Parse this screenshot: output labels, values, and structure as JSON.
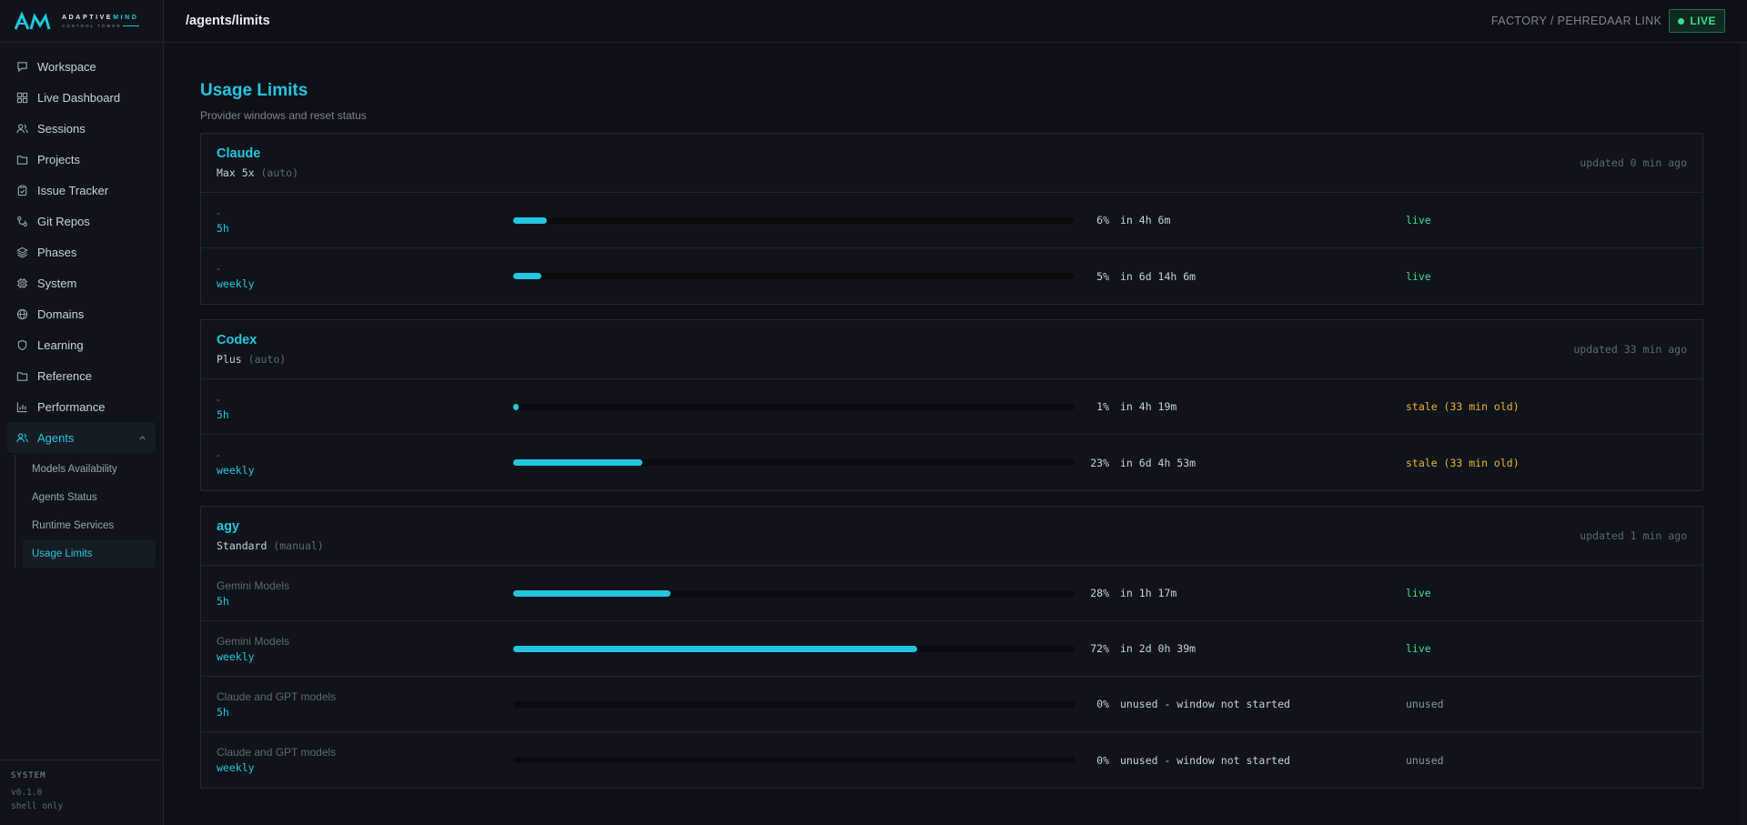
{
  "brand": {
    "name_a": "ADAPTIVE",
    "name_b": "MIND",
    "sub": "CONTROL TOWER"
  },
  "nav": {
    "items": [
      {
        "label": "Workspace",
        "icon": "chat-icon"
      },
      {
        "label": "Live Dashboard",
        "icon": "grid-icon"
      },
      {
        "label": "Sessions",
        "icon": "users-icon"
      },
      {
        "label": "Projects",
        "icon": "folder-icon"
      },
      {
        "label": "Issue Tracker",
        "icon": "clipboard-icon"
      },
      {
        "label": "Git Repos",
        "icon": "git-icon"
      },
      {
        "label": "Phases",
        "icon": "layers-icon"
      },
      {
        "label": "System",
        "icon": "cpu-icon"
      },
      {
        "label": "Domains",
        "icon": "globe-icon"
      },
      {
        "label": "Learning",
        "icon": "shield-icon"
      },
      {
        "label": "Reference",
        "icon": "folder-icon"
      },
      {
        "label": "Performance",
        "icon": "bar-chart-icon"
      },
      {
        "label": "Agents",
        "icon": "users-icon"
      }
    ],
    "agents_sub": [
      {
        "label": "Models Availability"
      },
      {
        "label": "Agents Status"
      },
      {
        "label": "Runtime Services"
      },
      {
        "label": "Usage Limits"
      }
    ]
  },
  "system": {
    "label": "SYSTEM",
    "version": "v0.1.0",
    "mode": "shell only"
  },
  "topbar": {
    "route": "/agents/limits",
    "factory": "FACTORY / PEHREDAAR LINK",
    "live": "LIVE"
  },
  "page": {
    "title": "Usage Limits",
    "subtitle": "Provider windows and reset status"
  },
  "colors": {
    "accent": "#22c6e0",
    "live": "#3ddc97",
    "stale": "#f0b429",
    "unused": "#8b949e"
  },
  "providers": [
    {
      "name": "Claude",
      "plan": "Max 5x",
      "mode": "(auto)",
      "updated": "updated 0 min ago",
      "rows": [
        {
          "name": "-",
          "window": "5h",
          "percent": 6,
          "pct_label": "6%",
          "reset": "in 4h 6m",
          "status": "live",
          "status_type": "live"
        },
        {
          "name": "-",
          "window": "weekly",
          "percent": 5,
          "pct_label": "5%",
          "reset": "in 6d 14h 6m",
          "status": "live",
          "status_type": "live"
        }
      ]
    },
    {
      "name": "Codex",
      "plan": "Plus",
      "mode": "(auto)",
      "updated": "updated 33 min ago",
      "rows": [
        {
          "name": "-",
          "window": "5h",
          "percent": 1,
          "pct_label": "1%",
          "reset": "in 4h 19m",
          "status": "stale (33 min old)",
          "status_type": "stale"
        },
        {
          "name": "-",
          "window": "weekly",
          "percent": 23,
          "pct_label": "23%",
          "reset": "in 6d 4h 53m",
          "status": "stale (33 min old)",
          "status_type": "stale"
        }
      ]
    },
    {
      "name": "agy",
      "plan": "Standard",
      "mode": "(manual)",
      "updated": "updated 1 min ago",
      "rows": [
        {
          "name": "Gemini Models",
          "window": "5h",
          "percent": 28,
          "pct_label": "28%",
          "reset": "in 1h 17m",
          "status": "live",
          "status_type": "live"
        },
        {
          "name": "Gemini Models",
          "window": "weekly",
          "percent": 72,
          "pct_label": "72%",
          "reset": "in 2d 0h 39m",
          "status": "live",
          "status_type": "live"
        },
        {
          "name": "Claude and GPT models",
          "window": "5h",
          "percent": 0,
          "pct_label": "0%",
          "reset": "unused - window not started",
          "status": "unused",
          "status_type": "unused"
        },
        {
          "name": "Claude and GPT models",
          "window": "weekly",
          "percent": 0,
          "pct_label": "0%",
          "reset": "unused - window not started",
          "status": "unused",
          "status_type": "unused"
        }
      ]
    }
  ]
}
